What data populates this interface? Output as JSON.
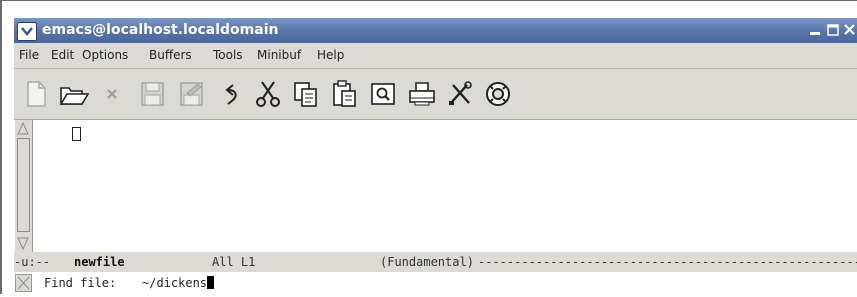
{
  "window": {
    "title": "emacs@localhost.localdomain",
    "controls": [
      "minimize-icon",
      "maximize-icon",
      "close-icon"
    ]
  },
  "menubar": {
    "items": [
      "File",
      "Edit",
      "Options",
      "Buffers",
      "Tools",
      "Minibuf",
      "Help"
    ]
  },
  "toolbar": {
    "icons": [
      "new-file-icon",
      "open-folder-icon",
      "close-buffer-icon",
      "save-icon",
      "save-as-icon",
      "undo-icon",
      "cut-icon",
      "copy-icon",
      "paste-icon",
      "search-icon",
      "print-icon",
      "preferences-icon",
      "help-icon"
    ]
  },
  "modeline": {
    "prefix": "-u:--",
    "buffer": "newfile",
    "position": "All L1",
    "mode": "(Fundamental)",
    "fill": "------------------------------------------------------"
  },
  "minibuffer": {
    "prompt": "Find file:",
    "value": "~/dickens"
  },
  "colors": {
    "titlebar": "#5873a8",
    "chrome": "#dcdad5",
    "text_area": "#ffffff"
  }
}
